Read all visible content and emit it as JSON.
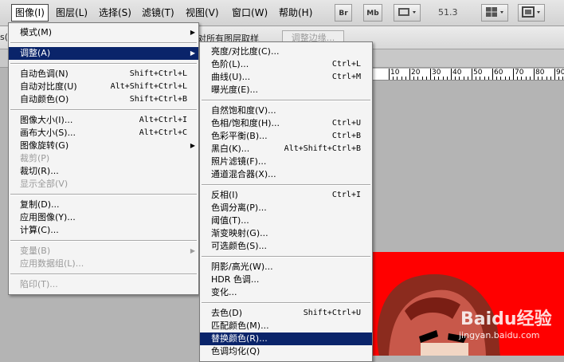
{
  "menubar": {
    "items": [
      "图像(I)",
      "图层(L)",
      "选择(S)",
      "滤镜(T)",
      "视图(V)",
      "窗口(W)",
      "帮助(H)"
    ],
    "icons": [
      "Br",
      "Mb"
    ],
    "zoom": "51.3"
  },
  "options_bar": {
    "partial_label": "对所有图层取样",
    "adjust_button": "调整边缘...",
    "left_fragment": "s("
  },
  "ruler_labels": [
    "10",
    "20",
    "30",
    "40",
    "50",
    "60",
    "70",
    "80",
    "90"
  ],
  "image_menu": {
    "items": [
      {
        "label": "模式(M)",
        "shortcut": "",
        "submenu": true
      },
      {
        "sep": true
      },
      {
        "label": "调整(A)",
        "shortcut": "",
        "submenu": true,
        "selected": true
      },
      {
        "sep": true
      },
      {
        "label": "自动色调(N)",
        "shortcut": "Shift+Ctrl+L"
      },
      {
        "label": "自动对比度(U)",
        "shortcut": "Alt+Shift+Ctrl+L"
      },
      {
        "label": "自动颜色(O)",
        "shortcut": "Shift+Ctrl+B"
      },
      {
        "sep": true
      },
      {
        "label": "图像大小(I)...",
        "shortcut": "Alt+Ctrl+I"
      },
      {
        "label": "画布大小(S)...",
        "shortcut": "Alt+Ctrl+C"
      },
      {
        "label": "图像旋转(G)",
        "shortcut": "",
        "submenu": true
      },
      {
        "label": "裁剪(P)",
        "shortcut": "",
        "disabled": true
      },
      {
        "label": "裁切(R)...",
        "shortcut": ""
      },
      {
        "label": "显示全部(V)",
        "shortcut": "",
        "disabled": true
      },
      {
        "sep": true
      },
      {
        "label": "复制(D)...",
        "shortcut": ""
      },
      {
        "label": "应用图像(Y)...",
        "shortcut": ""
      },
      {
        "label": "计算(C)...",
        "shortcut": ""
      },
      {
        "sep": true
      },
      {
        "label": "变量(B)",
        "shortcut": "",
        "submenu": true,
        "disabled": true
      },
      {
        "label": "应用数据组(L)...",
        "shortcut": "",
        "disabled": true
      },
      {
        "sep": true
      },
      {
        "label": "陷印(T)...",
        "shortcut": "",
        "disabled": true
      }
    ]
  },
  "adjust_menu": {
    "items": [
      {
        "label": "亮度/对比度(C)...",
        "shortcut": ""
      },
      {
        "label": "色阶(L)...",
        "shortcut": "Ctrl+L"
      },
      {
        "label": "曲线(U)...",
        "shortcut": "Ctrl+M"
      },
      {
        "label": "曝光度(E)...",
        "shortcut": ""
      },
      {
        "sep": true
      },
      {
        "label": "自然饱和度(V)...",
        "shortcut": ""
      },
      {
        "label": "色相/饱和度(H)...",
        "shortcut": "Ctrl+U"
      },
      {
        "label": "色彩平衡(B)...",
        "shortcut": "Ctrl+B"
      },
      {
        "label": "黑白(K)...",
        "shortcut": "Alt+Shift+Ctrl+B"
      },
      {
        "label": "照片滤镜(F)...",
        "shortcut": ""
      },
      {
        "label": "通道混合器(X)...",
        "shortcut": ""
      },
      {
        "sep": true
      },
      {
        "label": "反相(I)",
        "shortcut": "Ctrl+I"
      },
      {
        "label": "色调分离(P)...",
        "shortcut": ""
      },
      {
        "label": "阈值(T)...",
        "shortcut": ""
      },
      {
        "label": "渐变映射(G)...",
        "shortcut": ""
      },
      {
        "label": "可选颜色(S)...",
        "shortcut": ""
      },
      {
        "sep": true
      },
      {
        "label": "阴影/高光(W)...",
        "shortcut": ""
      },
      {
        "label": "HDR 色调...",
        "shortcut": ""
      },
      {
        "label": "变化...",
        "shortcut": ""
      },
      {
        "sep": true
      },
      {
        "label": "去色(D)",
        "shortcut": "Shift+Ctrl+U"
      },
      {
        "label": "匹配颜色(M)...",
        "shortcut": ""
      },
      {
        "label": "替换颜色(R)...",
        "shortcut": "",
        "selected": true
      },
      {
        "label": "色调均化(Q)",
        "shortcut": ""
      }
    ]
  },
  "watermark": {
    "brand": "Baidu经验",
    "url": "jingyan.baidu.com"
  },
  "colors": {
    "selection": "#0a246a",
    "canvas": "#ff0000"
  }
}
